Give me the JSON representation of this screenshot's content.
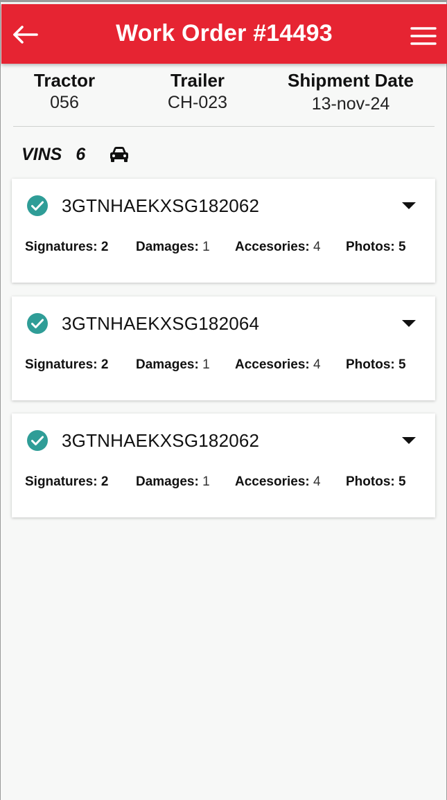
{
  "header": {
    "title": "Work Order #14493",
    "accent_color": "#e62432"
  },
  "info": {
    "tractor_label": "Tractor",
    "tractor_value": "056",
    "trailer_label": "Trailer",
    "trailer_value": "CH-023",
    "date_label": "Shipment Date",
    "date_value": "13-nov-24"
  },
  "vins": {
    "label": "VINS",
    "count": "6",
    "icon": "car-icon"
  },
  "cards": [
    {
      "vin": "3GTNHAEKXSG182062",
      "signatures_label": "Signatures:",
      "signatures": "2",
      "damages_label": "Damages:",
      "damages": "1",
      "accessories_label": "Accesories:",
      "accessories": "4",
      "photos_label": "Photos:",
      "photos": "5"
    },
    {
      "vin": "3GTNHAEKXSG182064",
      "signatures_label": "Signatures:",
      "signatures": "2",
      "damages_label": "Damages:",
      "damages": "1",
      "accessories_label": "Accesories:",
      "accessories": "4",
      "photos_label": "Photos:",
      "photos": "5"
    },
    {
      "vin": "3GTNHAEKXSG182062",
      "signatures_label": "Signatures:",
      "signatures": "2",
      "damages_label": "Damages:",
      "damages": "1",
      "accessories_label": "Accesories:",
      "accessories": "4",
      "photos_label": "Photos:",
      "photos": "5"
    }
  ],
  "colors": {
    "check": "#2f9d97"
  }
}
